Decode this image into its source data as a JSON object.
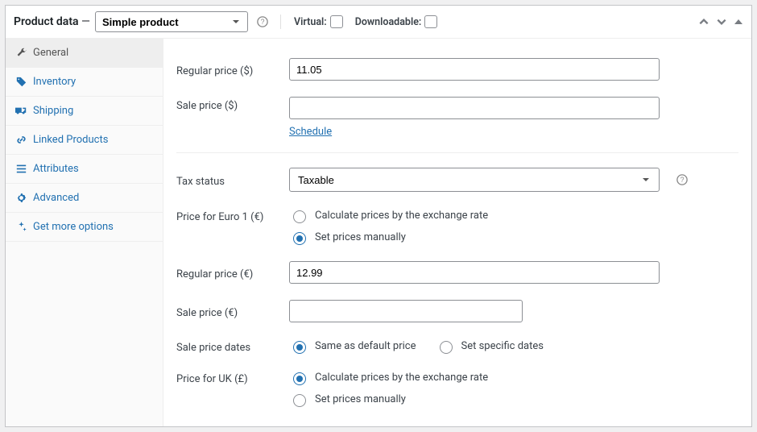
{
  "panel": {
    "title": "Product data",
    "dash": "—",
    "product_type": "Simple product",
    "virtual_label": "Virtual:",
    "downloadable_label": "Downloadable:",
    "virtual_checked": false,
    "downloadable_checked": false
  },
  "tabs": [
    {
      "id": "general",
      "label": "General",
      "icon": "wrench-icon",
      "active": true
    },
    {
      "id": "inventory",
      "label": "Inventory",
      "icon": "tag-icon",
      "active": false
    },
    {
      "id": "shipping",
      "label": "Shipping",
      "icon": "truck-icon",
      "active": false
    },
    {
      "id": "linked",
      "label": "Linked Products",
      "icon": "link-icon",
      "active": false
    },
    {
      "id": "attributes",
      "label": "Attributes",
      "icon": "list-icon",
      "active": false
    },
    {
      "id": "advanced",
      "label": "Advanced",
      "icon": "gear-icon",
      "active": false
    },
    {
      "id": "more",
      "label": "Get more options",
      "icon": "sparkle-icon",
      "active": false
    }
  ],
  "fields": {
    "regular_price_usd": {
      "label": "Regular price ($)",
      "value": "11.05"
    },
    "sale_price_usd": {
      "label": "Sale price ($)",
      "value": "",
      "schedule": "Schedule"
    },
    "tax_status": {
      "label": "Tax status",
      "value": "Taxable"
    },
    "price_eur": {
      "label": "Price for Euro 1 (€)",
      "options": {
        "calc": "Calculate prices by the exchange rate",
        "manual": "Set prices manually"
      },
      "selected": "manual"
    },
    "regular_price_eur": {
      "label": "Regular price (€)",
      "value": "12.99"
    },
    "sale_price_eur": {
      "label": "Sale price (€)",
      "value": ""
    },
    "sale_price_dates": {
      "label": "Sale price dates",
      "options": {
        "same": "Same as default price",
        "specific": "Set specific dates"
      },
      "selected": "same"
    },
    "price_uk": {
      "label": "Price for UK (£)",
      "options": {
        "calc": "Calculate prices by the exchange rate",
        "manual": "Set prices manually"
      },
      "selected": "calc"
    }
  }
}
